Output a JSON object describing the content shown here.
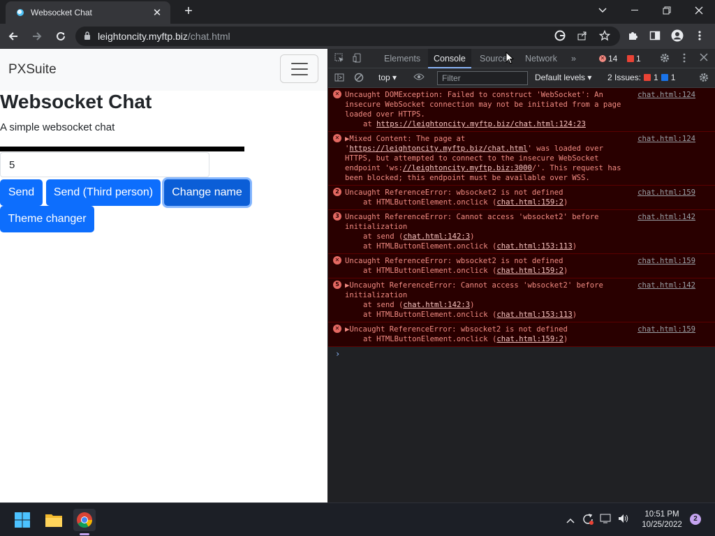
{
  "browser": {
    "tab_title": "Websocket Chat",
    "tab_close": "✕",
    "new_tab": "+",
    "url_host": "leightoncity.myftp.biz",
    "url_path": "/chat.html"
  },
  "page": {
    "brand": "PXSuite",
    "title": "Websocket Chat",
    "subtitle": "A simple websocket chat",
    "input_value": "5",
    "buttons": {
      "send": "Send",
      "send_third": "Send (Third person)",
      "change_name": "Change name",
      "theme": "Theme changer"
    }
  },
  "devtools": {
    "tabs": [
      "Elements",
      "Console",
      "Sources",
      "Network",
      "»"
    ],
    "active_tab": "Console",
    "error_count": "14",
    "warning_count": "1",
    "context": "top ▾",
    "filter_placeholder": "Filter",
    "levels": "Default levels ▾",
    "issues_label": "2 Issues:",
    "issues_red": "1",
    "issues_blue": "1",
    "messages": [
      {
        "mark": "✕",
        "source": "chat.html:124",
        "lines": [
          "Uncaught DOMException: Failed to construct 'WebSocket': An insecure WebSocket connection may not be initiated from a page loaded over HTTPS."
        ],
        "trace_prefix": "at ",
        "trace_link": "https://leightoncity.myftp.biz/chat.html:124:23"
      },
      {
        "mark": "✕",
        "source": "chat.html:124",
        "prefix": "▶Mixed Content: The page at '",
        "link1": "https://leightoncity.myftp.biz/chat.html",
        "mid": "' was loaded over HTTPS, but attempted to connect to the insecure WebSocket endpoint 'ws:",
        "link2": "//leightoncity.myftp.biz:3000",
        "suffix": "/'. This request has been blocked; this endpoint must be available over WSS."
      },
      {
        "mark": "2",
        "source": "chat.html:159",
        "text": "Uncaught ReferenceError: wbsocket2 is not defined",
        "traces": [
          {
            "pre": "at HTMLButtonElement.onclick (",
            "link": "chat.html:159:2",
            "post": ")"
          }
        ]
      },
      {
        "mark": "3",
        "source": "chat.html:142",
        "text": "Uncaught ReferenceError: Cannot access 'wbsocket2' before initialization",
        "traces": [
          {
            "pre": "at send (",
            "link": "chat.html:142:3",
            "post": ")"
          },
          {
            "pre": "at HTMLButtonElement.onclick (",
            "link": "chat.html:153:113",
            "post": ")"
          }
        ]
      },
      {
        "mark": "✕",
        "source": "chat.html:159",
        "text": "Uncaught ReferenceError: wbsocket2 is not defined",
        "traces": [
          {
            "pre": "at HTMLButtonElement.onclick (",
            "link": "chat.html:159:2",
            "post": ")"
          }
        ]
      },
      {
        "mark": "5",
        "source": "chat.html:142",
        "text": "▶Uncaught ReferenceError: Cannot access 'wbsocket2' before initialization",
        "traces": [
          {
            "pre": "at send (",
            "link": "chat.html:142:3",
            "post": ")"
          },
          {
            "pre": "at HTMLButtonElement.onclick (",
            "link": "chat.html:153:113",
            "post": ")"
          }
        ]
      },
      {
        "mark": "✕",
        "source": "chat.html:159",
        "text": "▶Uncaught ReferenceError: wbsocket2 is not defined",
        "traces": [
          {
            "pre": "at HTMLButtonElement.onclick (",
            "link": "chat.html:159:2",
            "post": ")"
          }
        ]
      }
    ],
    "prompt": "›"
  },
  "taskbar": {
    "time": "10:51 PM",
    "date": "10/25/2022",
    "notifications": "2"
  },
  "colors": {
    "bootstrap_primary": "#0d6efd",
    "console_error_bg": "#290000",
    "console_error_text": "#f28b82",
    "chrome_dark": "#202124"
  }
}
